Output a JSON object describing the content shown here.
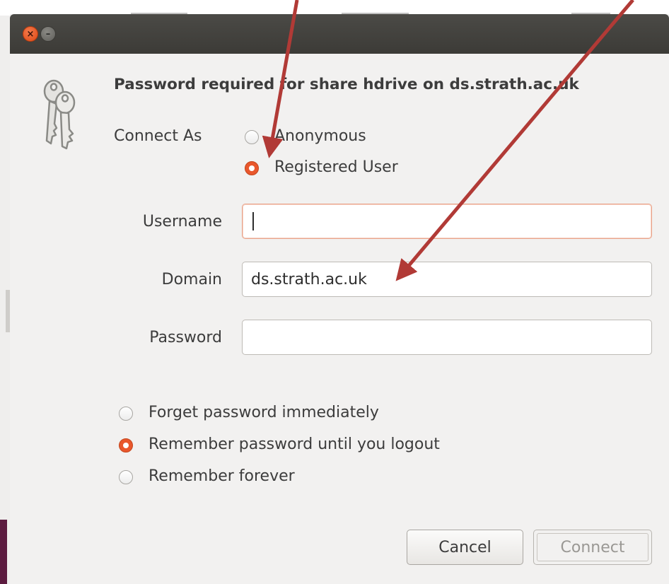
{
  "dialog": {
    "heading": "Password required for share hdrive on ds.strath.ac.uk",
    "connect_as": {
      "label": "Connect As",
      "options": [
        {
          "label": "Anonymous",
          "checked": false
        },
        {
          "label": "Registered User",
          "checked": true
        }
      ]
    },
    "fields": {
      "username": {
        "label": "Username",
        "value": ""
      },
      "domain": {
        "label": "Domain",
        "value": "ds.strath.ac.uk"
      },
      "password": {
        "label": "Password",
        "value": ""
      }
    },
    "remember": {
      "options": [
        {
          "label": "Forget password immediately",
          "checked": false
        },
        {
          "label": "Remember password until you logout",
          "checked": true
        },
        {
          "label": "Remember forever",
          "checked": false
        }
      ]
    },
    "buttons": {
      "cancel": "Cancel",
      "connect": "Connect"
    }
  },
  "icons": {
    "window_close": "close-icon",
    "window_minimize": "minimize-icon",
    "dialog_icon": "keys-icon"
  },
  "colors": {
    "titlebar": "#3c3b37",
    "accent": "#e9572c",
    "annotation_arrow": "#b13a36"
  }
}
